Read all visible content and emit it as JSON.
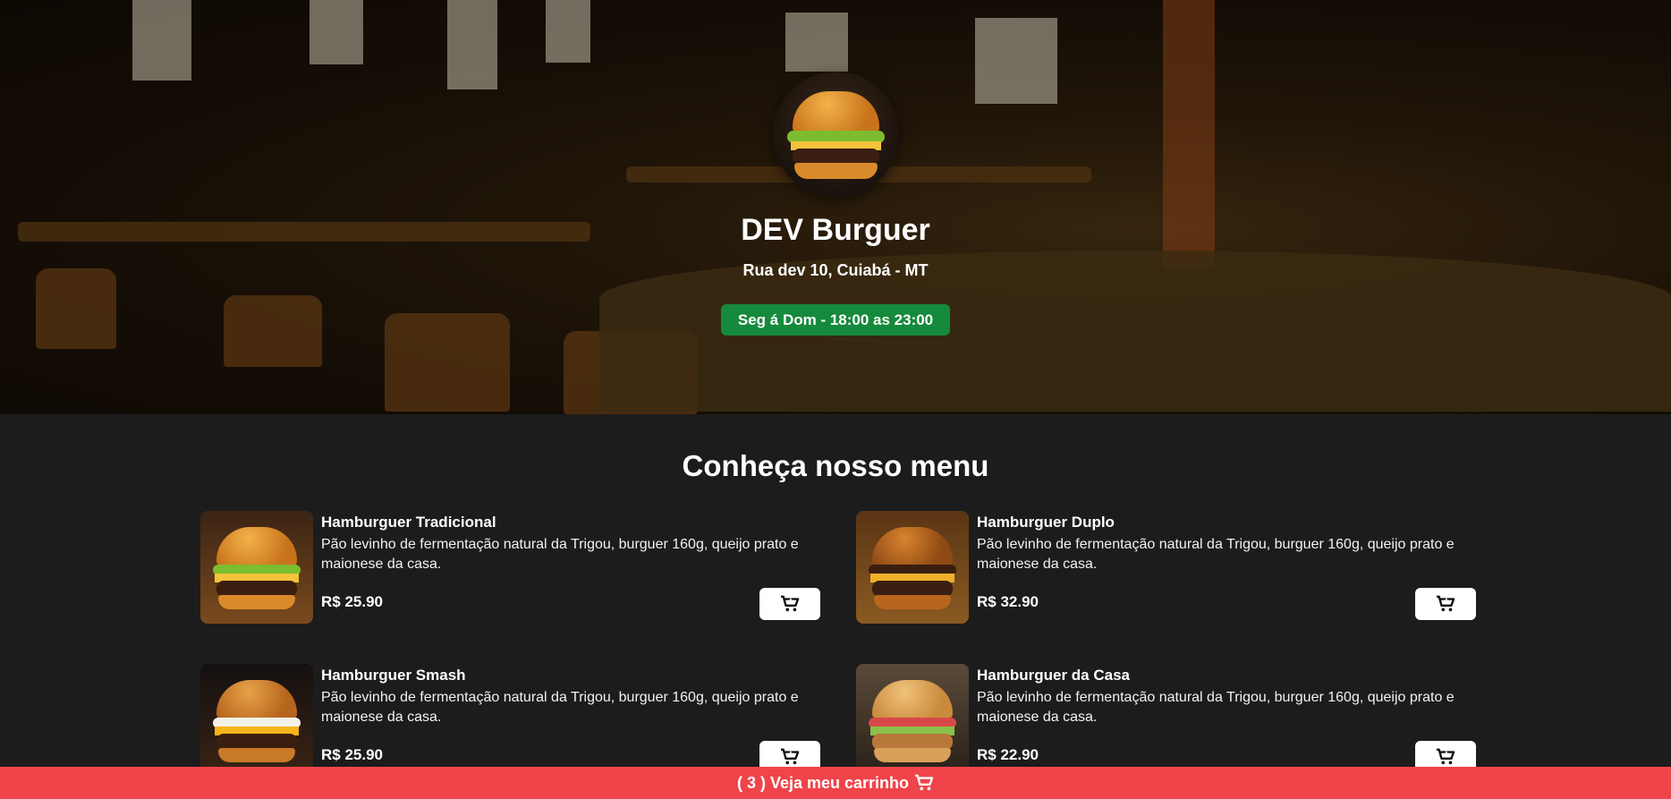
{
  "header": {
    "restaurant_name": "DEV Burguer",
    "address": "Rua dev 10, Cuiabá - MT",
    "hours": "Seg á Dom - 18:00 as 23:00"
  },
  "menu": {
    "title": "Conheça nosso menu",
    "items": [
      {
        "name": "Hamburguer Tradicional",
        "description": "Pão levinho de fermentação natural da Trigou, burguer 160g, queijo prato e maionese da casa.",
        "price": "R$ 25.90"
      },
      {
        "name": "Hamburguer Duplo",
        "description": "Pão levinho de fermentação natural da Trigou, burguer 160g, queijo prato e maionese da casa.",
        "price": "R$ 32.90"
      },
      {
        "name": "Hamburguer Smash",
        "description": "Pão levinho de fermentação natural da Trigou, burguer 160g, queijo prato e maionese da casa.",
        "price": "R$ 25.90"
      },
      {
        "name": "Hamburguer da Casa",
        "description": "Pão levinho de fermentação natural da Trigou, burguer 160g, queijo prato e maionese da casa.",
        "price": "R$ 22.90"
      }
    ]
  },
  "cart": {
    "label": "( 3 ) Veja meu carrinho",
    "icon": "cart-icon"
  },
  "colors": {
    "page_background": "#1c1c1c",
    "hours_badge": "#168a3c",
    "cart_bar": "#ef444a",
    "cart_button": "#ffffff"
  }
}
